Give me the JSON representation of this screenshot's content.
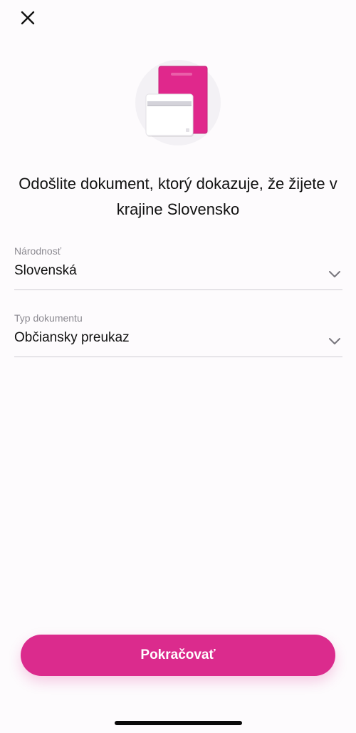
{
  "header": {
    "close_icon": "close-icon"
  },
  "hero": {
    "icon": "documents-illustration",
    "colors": {
      "passport": "#e0288c",
      "card": "#ffffff"
    }
  },
  "title": "Odošlite dokument, ktorý dokazuje, že žijete v krajine Slovensko",
  "nationality": {
    "label": "Národnosť",
    "value": "Slovenská",
    "icon": "chevron-down-icon"
  },
  "document_type": {
    "label": "Typ dokumentu",
    "value": "Občiansky preukaz",
    "icon": "chevron-down-icon"
  },
  "continue_button": {
    "label": "Pokračovať",
    "color": "#db2b8d"
  }
}
